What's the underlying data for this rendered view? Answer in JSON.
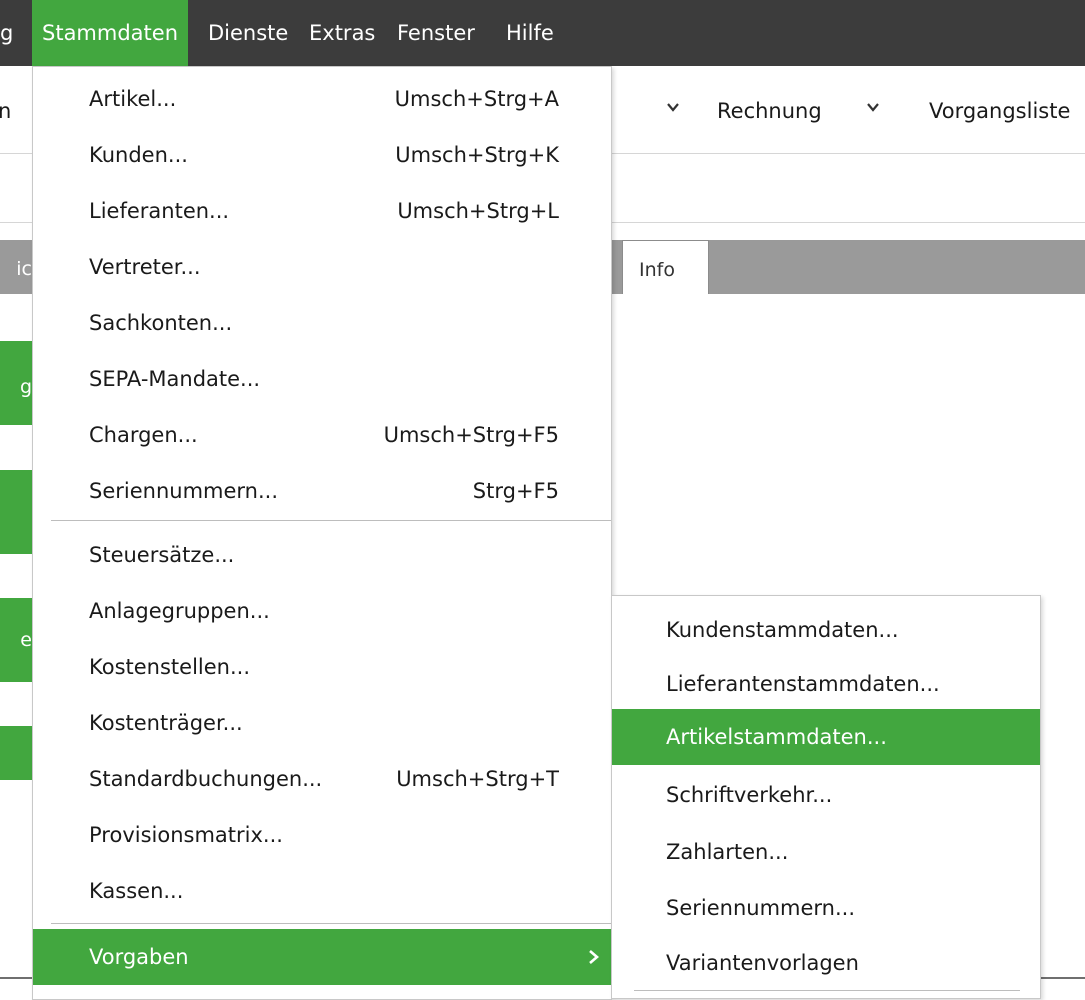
{
  "menubar": {
    "partial_left": "g",
    "items": [
      "Stammdaten",
      "Dienste",
      "Extras",
      "Fenster",
      "Hilfe"
    ]
  },
  "toolbar": {
    "partial_left": "n",
    "rechnung": "Rechnung",
    "vorgangsliste": "Vorgangsliste"
  },
  "tabs": {
    "partial_left": "ic",
    "info": "Info"
  },
  "side_buttons": [
    "g",
    "",
    "e",
    ""
  ],
  "menu": {
    "items": [
      {
        "label": "Artikel...",
        "shortcut": "Umsch+Strg+A"
      },
      {
        "label": "Kunden...",
        "shortcut": "Umsch+Strg+K"
      },
      {
        "label": "Lieferanten...",
        "shortcut": "Umsch+Strg+L"
      },
      {
        "label": "Vertreter...",
        "shortcut": ""
      },
      {
        "label": "Sachkonten...",
        "shortcut": ""
      },
      {
        "label": "SEPA-Mandate...",
        "shortcut": ""
      },
      {
        "label": "Chargen...",
        "shortcut": "Umsch+Strg+F5"
      },
      {
        "label": "Seriennummern...",
        "shortcut": "Strg+F5"
      },
      {
        "label": "Steuersätze...",
        "shortcut": ""
      },
      {
        "label": "Anlagegruppen...",
        "shortcut": ""
      },
      {
        "label": "Kostenstellen...",
        "shortcut": ""
      },
      {
        "label": "Kostenträger...",
        "shortcut": ""
      },
      {
        "label": "Standardbuchungen...",
        "shortcut": "Umsch+Strg+T"
      },
      {
        "label": "Provisionsmatrix...",
        "shortcut": ""
      },
      {
        "label": "Kassen...",
        "shortcut": ""
      },
      {
        "label": "Vorgaben",
        "shortcut": ""
      }
    ]
  },
  "submenu": {
    "items": [
      "Kundenstammdaten...",
      "Lieferantenstammdaten...",
      "Artikelstammdaten...",
      "Schriftverkehr...",
      "Zahlarten...",
      "Seriennummern...",
      "Variantenvorlagen"
    ]
  },
  "colors": {
    "accent": "#42a73f",
    "menubar_bg": "#3c3c3c",
    "tabstrip_bg": "#9a9a9a"
  },
  "icons": {
    "submenu_arrow": "chevron-right-icon",
    "dropdown_chevron": "chevron-down-icon"
  }
}
